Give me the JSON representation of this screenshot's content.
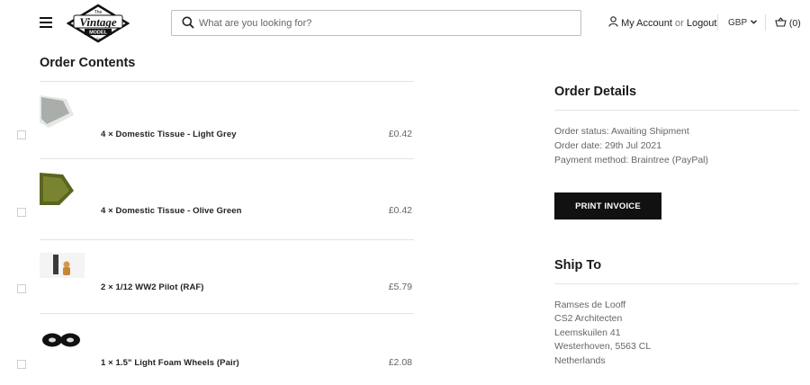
{
  "header": {
    "logo": {
      "text_top": "The",
      "text_main": "Vintage",
      "text_sub": "MODEL",
      "text_bottom": "Co"
    },
    "search_placeholder": "What are you looking for?",
    "account_label": "My Account",
    "or_label": "or",
    "logout_label": "Logout",
    "currency": "GBP",
    "cart_count": "(0)"
  },
  "order_contents": {
    "title": "Order Contents",
    "items": [
      {
        "name": "4 × Domestic Tissue - Light Grey",
        "price": "£0.42",
        "thumb_color": "#b8bdb8"
      },
      {
        "name": "4 × Domestic Tissue - Olive Green",
        "price": "£0.42",
        "thumb_color": "#6b7426"
      },
      {
        "name": "2 × 1/12 WW2 Pilot (RAF)",
        "price": "£5.79",
        "thumb_color": "#c9a36a"
      },
      {
        "name": "1 × 1.5\" Light Foam Wheels (Pair)",
        "price": "£2.08",
        "thumb_color": "#111111"
      }
    ]
  },
  "order_details": {
    "title": "Order Details",
    "status": "Order status: Awaiting Shipment",
    "date": "Order date: 29th Jul 2021",
    "payment": "Payment method: Braintree (PayPal)",
    "print_label": "PRINT INVOICE"
  },
  "ship_to": {
    "title": "Ship To",
    "lines": [
      "Ramses de Looff",
      "CS2 Architecten",
      "Leemskuilen 41",
      "Westerhoven, 5563 CL",
      "Netherlands"
    ]
  }
}
